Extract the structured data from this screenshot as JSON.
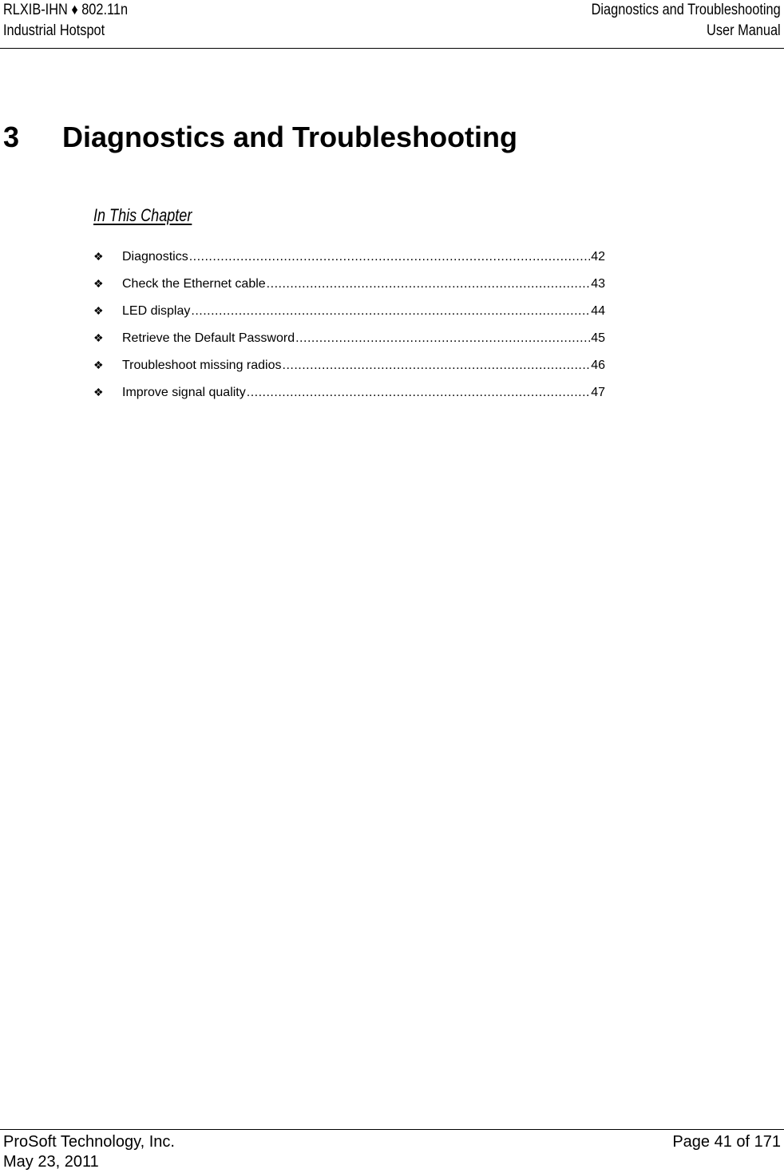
{
  "header": {
    "left_line1": "RLXIB-IHN ♦ 802.11n",
    "left_line2": "Industrial Hotspot",
    "right_line1": "Diagnostics and Troubleshooting",
    "right_line2": "User Manual"
  },
  "chapter": {
    "number": "3",
    "title": "Diagnostics and Troubleshooting"
  },
  "in_this_chapter": {
    "label": "In This Chapter",
    "bullet_icon": "❖",
    "items": [
      {
        "title": "Diagnostics",
        "page": "42"
      },
      {
        "title": "Check the Ethernet cable",
        "page": "43"
      },
      {
        "title": "LED display",
        "page": "44"
      },
      {
        "title": "Retrieve the Default Password",
        "page": "45"
      },
      {
        "title": "Troubleshoot missing radios",
        "page": "46"
      },
      {
        "title": "Improve signal quality",
        "page": "47"
      }
    ]
  },
  "footer": {
    "company": "ProSoft Technology, Inc.",
    "date": "May 23, 2011",
    "page_label": "Page 41 of 171"
  }
}
